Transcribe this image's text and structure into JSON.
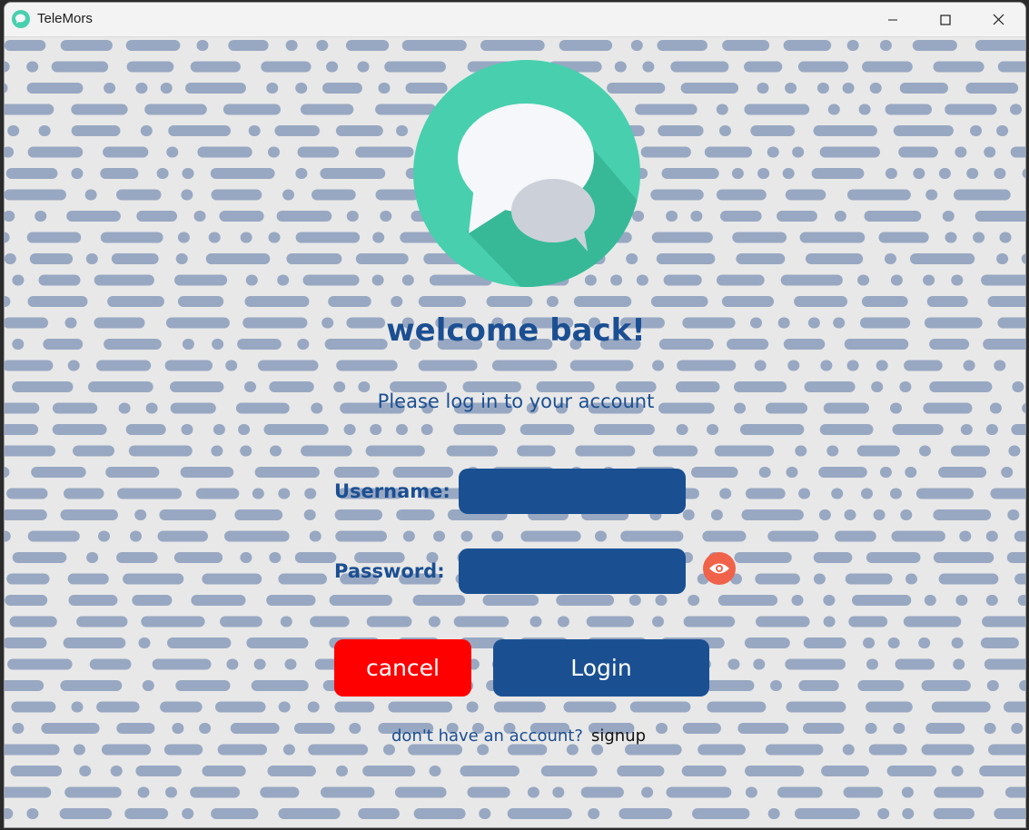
{
  "window": {
    "title": "TeleMors",
    "controls": [
      "minimize-icon",
      "maximize-icon",
      "close-icon"
    ]
  },
  "login": {
    "welcome": "welcome back!",
    "subtitle": "Please log in to your account",
    "username_label": "Username:",
    "username_value": "",
    "password_label": "Password:",
    "password_value": "",
    "show_password_icon": "eye-icon",
    "cancel_label": "cancel",
    "login_label": "Login",
    "no_account_text": "don't have an account?",
    "signup_label": "signup"
  },
  "colors": {
    "primary_blue": "#1a5092",
    "cancel_red": "#ff0000",
    "eye_orange": "#f06249",
    "logo_green": "#48cfae",
    "pattern_blue": "#3b5e98"
  }
}
